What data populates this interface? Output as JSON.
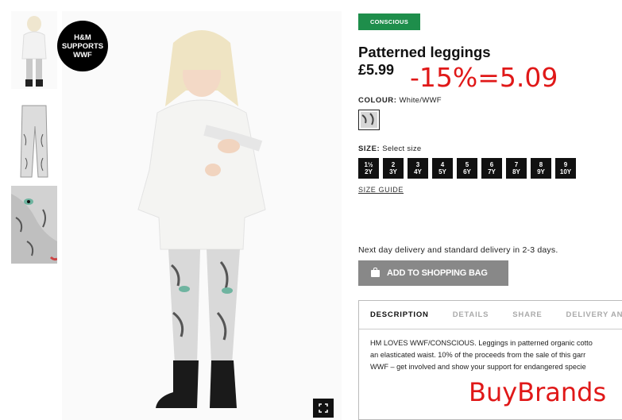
{
  "badge": {
    "line1": "H&M",
    "line2": "SUPPORTS",
    "line3": "WWF"
  },
  "product": {
    "tag": "CONSCIOUS",
    "title": "Patterned leggings",
    "price": "£5.99",
    "discount_note": "-15%=5.09",
    "colour_label": "COLOUR:",
    "colour_value": "White/WWF",
    "size_label": "SIZE:",
    "size_prompt": "Select size",
    "sizes": [
      {
        "top": "1½",
        "bottom": "2Y"
      },
      {
        "top": "2",
        "bottom": "3Y"
      },
      {
        "top": "3",
        "bottom": "4Y"
      },
      {
        "top": "4",
        "bottom": "5Y"
      },
      {
        "top": "5",
        "bottom": "6Y"
      },
      {
        "top": "6",
        "bottom": "7Y"
      },
      {
        "top": "7",
        "bottom": "8Y"
      },
      {
        "top": "8",
        "bottom": "9Y"
      },
      {
        "top": "9",
        "bottom": "10Y"
      }
    ],
    "size_guide": "SIZE GUIDE",
    "delivery": "Next day delivery and standard delivery in 2-3 days.",
    "add_to_bag": "ADD TO SHOPPING BAG"
  },
  "tabs": [
    "DESCRIPTION",
    "DETAILS",
    "SHARE",
    "DELIVERY AND"
  ],
  "description": [
    "HM LOVES WWF/CONSCIOUS. Leggings in patterned organic cotto",
    "an elasticated waist. 10% of the proceeds from the sale of this garr",
    "WWF – get involved and show your support for endangered specie"
  ],
  "watermark": "BuyBrands",
  "colors": {
    "conscious_green": "#1e8e4b",
    "button_grey": "#888888",
    "annotation_red": "#e01818"
  }
}
